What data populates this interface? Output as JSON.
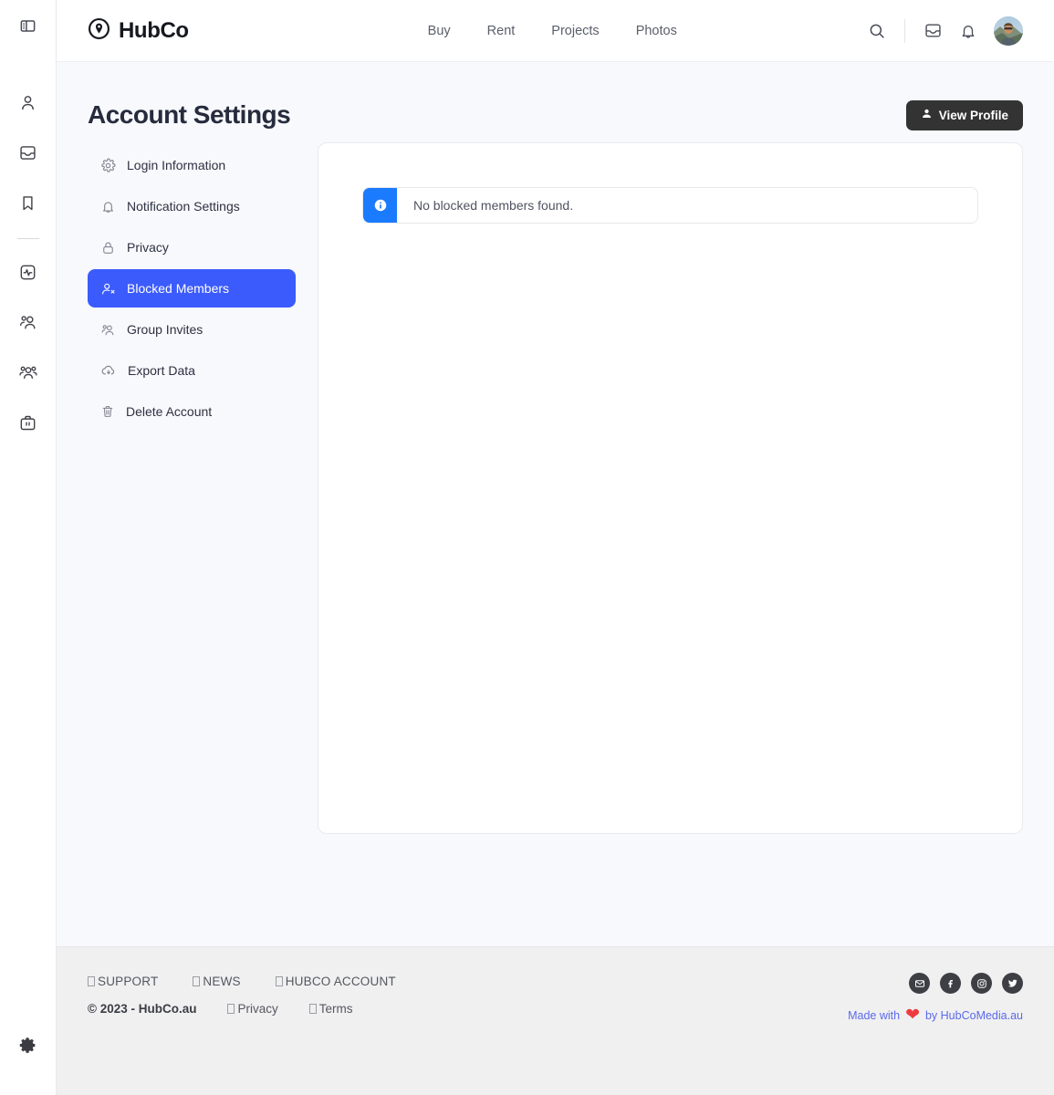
{
  "rail": {
    "toggle_icon": "sidebar-toggle-icon",
    "items": [
      {
        "icon": "person-icon",
        "name": "profile"
      },
      {
        "icon": "inbox-icon",
        "name": "inbox"
      },
      {
        "icon": "bookmark-icon",
        "name": "saved"
      },
      {
        "icon": "activity-icon",
        "name": "activity"
      },
      {
        "icon": "people-pair-icon",
        "name": "connections"
      },
      {
        "icon": "people-group-icon",
        "name": "groups"
      },
      {
        "icon": "briefcase-icon",
        "name": "jobs"
      }
    ],
    "settings_icon": "gear-icon"
  },
  "header": {
    "brand": "HubCo",
    "brand_icon": "location-pin-icon",
    "nav": [
      {
        "label": "Buy"
      },
      {
        "label": "Rent"
      },
      {
        "label": "Projects"
      },
      {
        "label": "Photos"
      }
    ],
    "search_icon": "search-icon",
    "inbox_icon": "inbox-icon",
    "bell_icon": "bell-icon",
    "avatar": "user-avatar"
  },
  "page": {
    "title": "Account Settings",
    "view_profile_label": "View Profile",
    "view_profile_icon": "person-icon"
  },
  "settings_nav": {
    "items": [
      {
        "label": "Login Information",
        "icon": "gear-icon",
        "active": false
      },
      {
        "label": "Notification Settings",
        "icon": "bell-icon",
        "active": false
      },
      {
        "label": "Privacy",
        "icon": "lock-icon",
        "active": false
      },
      {
        "label": "Blocked Members",
        "icon": "person-block-icon",
        "active": true
      },
      {
        "label": "Group Invites",
        "icon": "people-pair-icon",
        "active": false
      },
      {
        "label": "Export Data",
        "icon": "cloud-download-icon",
        "active": false
      },
      {
        "label": "Delete Account",
        "icon": "trash-icon",
        "active": false
      }
    ]
  },
  "panel": {
    "alert": {
      "icon": "info-icon",
      "message": "No blocked members found.",
      "accent_color": "#1a7bff"
    }
  },
  "footer": {
    "top_links": [
      {
        "label": "SUPPORT"
      },
      {
        "label": "NEWS"
      },
      {
        "label": "HUBCO ACCOUNT"
      }
    ],
    "copyright": "© 2023 - HubCo.au",
    "bottom_links": [
      {
        "label": "Privacy"
      },
      {
        "label": "Terms"
      }
    ],
    "socials": [
      {
        "name": "email-icon"
      },
      {
        "name": "facebook-icon"
      },
      {
        "name": "instagram-icon"
      },
      {
        "name": "twitter-icon"
      }
    ],
    "made_prefix": "Made with",
    "made_suffix": "by HubCoMedia.au",
    "heart_color": "#ee3b40",
    "made_color": "#5b6ae8"
  },
  "theme": {
    "accent_blue": "#3b5bfd",
    "info_blue": "#1a7bff",
    "page_bg": "#f8f9fc",
    "footer_bg": "#f0f0f1",
    "dark_button": "#333333"
  }
}
